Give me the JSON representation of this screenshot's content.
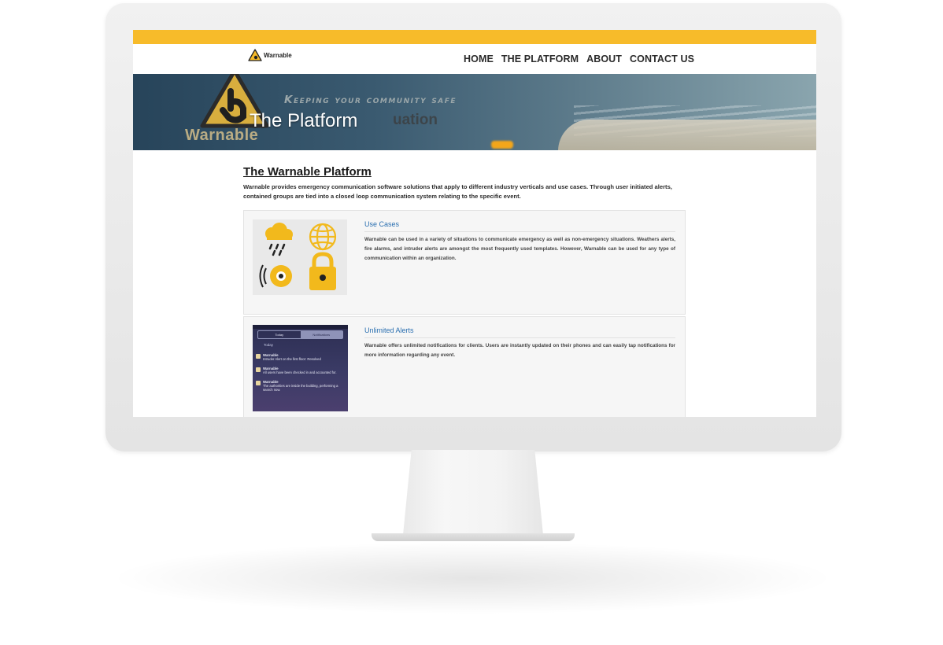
{
  "site": {
    "logo_text": "Warnable",
    "nav": [
      "HOME",
      "THE PLATFORM",
      "ABOUT",
      "CONTACT US"
    ]
  },
  "hero": {
    "tagline": "Keeping your community safe",
    "background_text": "uation",
    "background_brand": "Warnable",
    "title": "The Platform"
  },
  "main": {
    "heading": "The Warnable Platform",
    "intro": "Warnable provides emergency communication software solutions that apply to different industry verticals and use cases. Through user initiated alerts, contained groups are tied into a closed loop communication system relating to the specific event."
  },
  "cards": [
    {
      "title": "Use Cases",
      "text": "Warnable can be used in a variety of situations to communicate emergency as well as non-emergency situations. Weathers alerts, fire alarms, and intruder alerts are amongst the most frequently used templates. However, Warnable can be used for any type of communication within an organization."
    },
    {
      "title": "Unlimited Alerts",
      "text": "Warnable offers unlimited notifications for clients. Users are instantly updated on their phones and can easily tap notifications for more information regarding any event."
    }
  ],
  "phone": {
    "tabs": [
      "Today",
      "Notifications"
    ],
    "section": "Today",
    "notifications": [
      {
        "app": "Warnable",
        "text": "Intruder Alert on the first floor: Resolved"
      },
      {
        "app": "Warnable",
        "text": "All users have been checked in and accounted for."
      },
      {
        "app": "Warnable",
        "text": "The authorities are inside the building, performing a search now."
      }
    ]
  },
  "colors": {
    "accent": "#f7bb2a",
    "link": "#2a6fb0",
    "hero": "#27445a"
  }
}
